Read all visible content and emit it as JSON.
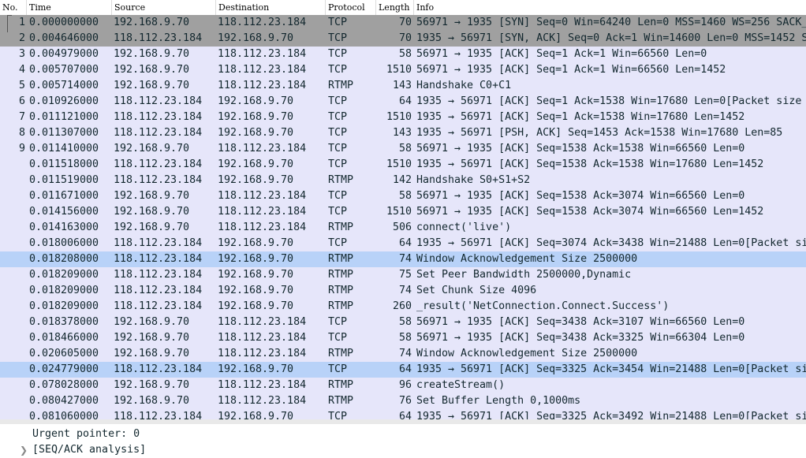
{
  "columns": {
    "no": "No.",
    "time": "Time",
    "source": "Source",
    "destination": "Destination",
    "protocol": "Protocol",
    "length": "Length",
    "info": "Info"
  },
  "packets": [
    {
      "no": "1",
      "time": "0.000000000",
      "src": "192.168.9.70",
      "dst": "118.112.23.184",
      "proto": "TCP",
      "len": "70",
      "info": "56971 → 1935 [SYN] Seq=0 Win=64240 Len=0 MSS=1460 WS=256 SACK_",
      "style": "sel-dark"
    },
    {
      "no": "2",
      "time": "0.004646000",
      "src": "118.112.23.184",
      "dst": "192.168.9.70",
      "proto": "TCP",
      "len": "70",
      "info": "1935 → 56971 [SYN, ACK] Seq=0 Ack=1 Win=14600 Len=0 MSS=1452 S",
      "style": "sel-dark"
    },
    {
      "no": "3",
      "time": "0.004979000",
      "src": "192.168.9.70",
      "dst": "118.112.23.184",
      "proto": "TCP",
      "len": "58",
      "info": "56971 → 1935 [ACK] Seq=1 Ack=1 Win=66560 Len=0",
      "style": ""
    },
    {
      "no": "4",
      "time": "0.005707000",
      "src": "192.168.9.70",
      "dst": "118.112.23.184",
      "proto": "TCP",
      "len": "1510",
      "info": "56971 → 1935 [ACK] Seq=1 Ack=1 Win=66560 Len=1452",
      "style": ""
    },
    {
      "no": "5",
      "time": "0.005714000",
      "src": "192.168.9.70",
      "dst": "118.112.23.184",
      "proto": "RTMP",
      "len": "143",
      "info": "Handshake C0+C1",
      "style": ""
    },
    {
      "no": "6",
      "time": "0.010926000",
      "src": "118.112.23.184",
      "dst": "192.168.9.70",
      "proto": "TCP",
      "len": "64",
      "info": "1935 → 56971 [ACK] Seq=1 Ack=1538 Win=17680 Len=0[Packet size",
      "style": ""
    },
    {
      "no": "7",
      "time": "0.011121000",
      "src": "118.112.23.184",
      "dst": "192.168.9.70",
      "proto": "TCP",
      "len": "1510",
      "info": "1935 → 56971 [ACK] Seq=1 Ack=1538 Win=17680 Len=1452",
      "style": ""
    },
    {
      "no": "8",
      "time": "0.011307000",
      "src": "118.112.23.184",
      "dst": "192.168.9.70",
      "proto": "TCP",
      "len": "143",
      "info": "1935 → 56971 [PSH, ACK] Seq=1453 Ack=1538 Win=17680 Len=85",
      "style": ""
    },
    {
      "no": "9",
      "time": "0.011410000",
      "src": "192.168.9.70",
      "dst": "118.112.23.184",
      "proto": "TCP",
      "len": "58",
      "info": "56971 → 1935 [ACK] Seq=1538 Ack=1538 Win=66560 Len=0",
      "style": ""
    },
    {
      "no": "",
      "time": "0.011518000",
      "src": "118.112.23.184",
      "dst": "192.168.9.70",
      "proto": "TCP",
      "len": "1510",
      "info": "1935 → 56971 [ACK] Seq=1538 Ack=1538 Win=17680 Len=1452",
      "style": ""
    },
    {
      "no": "",
      "time": "0.011519000",
      "src": "118.112.23.184",
      "dst": "192.168.9.70",
      "proto": "RTMP",
      "len": "142",
      "info": "Handshake S0+S1+S2",
      "style": ""
    },
    {
      "no": "",
      "time": "0.011671000",
      "src": "192.168.9.70",
      "dst": "118.112.23.184",
      "proto": "TCP",
      "len": "58",
      "info": "56971 → 1935 [ACK] Seq=1538 Ack=3074 Win=66560 Len=0",
      "style": ""
    },
    {
      "no": "",
      "time": "0.014156000",
      "src": "192.168.9.70",
      "dst": "118.112.23.184",
      "proto": "TCP",
      "len": "1510",
      "info": "56971 → 1935 [ACK] Seq=1538 Ack=3074 Win=66560 Len=1452",
      "style": ""
    },
    {
      "no": "",
      "time": "0.014163000",
      "src": "192.168.9.70",
      "dst": "118.112.23.184",
      "proto": "RTMP",
      "len": "506",
      "info": "connect('live')",
      "style": ""
    },
    {
      "no": "",
      "time": "0.018006000",
      "src": "118.112.23.184",
      "dst": "192.168.9.70",
      "proto": "TCP",
      "len": "64",
      "info": "1935 → 56971 [ACK] Seq=3074 Ack=3438 Win=21488 Len=0[Packet si",
      "style": ""
    },
    {
      "no": "",
      "time": "0.018208000",
      "src": "118.112.23.184",
      "dst": "192.168.9.70",
      "proto": "RTMP",
      "len": "74",
      "info": "Window Acknowledgement Size 2500000",
      "style": "sel-light"
    },
    {
      "no": "",
      "time": "0.018209000",
      "src": "118.112.23.184",
      "dst": "192.168.9.70",
      "proto": "RTMP",
      "len": "75",
      "info": "Set Peer Bandwidth 2500000,Dynamic",
      "style": ""
    },
    {
      "no": "",
      "time": "0.018209000",
      "src": "118.112.23.184",
      "dst": "192.168.9.70",
      "proto": "RTMP",
      "len": "74",
      "info": "Set Chunk Size 4096",
      "style": ""
    },
    {
      "no": "",
      "time": "0.018209000",
      "src": "118.112.23.184",
      "dst": "192.168.9.70",
      "proto": "RTMP",
      "len": "260",
      "info": "_result('NetConnection.Connect.Success')",
      "style": ""
    },
    {
      "no": "",
      "time": "0.018378000",
      "src": "192.168.9.70",
      "dst": "118.112.23.184",
      "proto": "TCP",
      "len": "58",
      "info": "56971 → 1935 [ACK] Seq=3438 Ack=3107 Win=66560 Len=0",
      "style": ""
    },
    {
      "no": "",
      "time": "0.018466000",
      "src": "192.168.9.70",
      "dst": "118.112.23.184",
      "proto": "TCP",
      "len": "58",
      "info": "56971 → 1935 [ACK] Seq=3438 Ack=3325 Win=66304 Len=0",
      "style": ""
    },
    {
      "no": "",
      "time": "0.020605000",
      "src": "192.168.9.70",
      "dst": "118.112.23.184",
      "proto": "RTMP",
      "len": "74",
      "info": "Window Acknowledgement Size 2500000",
      "style": ""
    },
    {
      "no": "",
      "time": "0.024779000",
      "src": "118.112.23.184",
      "dst": "192.168.9.70",
      "proto": "TCP",
      "len": "64",
      "info": "1935 → 56971 [ACK] Seq=3325 Ack=3454 Win=21488 Len=0[Packet si",
      "style": "sel-light"
    },
    {
      "no": "",
      "time": "0.078028000",
      "src": "192.168.9.70",
      "dst": "118.112.23.184",
      "proto": "RTMP",
      "len": "96",
      "info": "createStream()",
      "style": ""
    },
    {
      "no": "",
      "time": "0.080427000",
      "src": "192.168.9.70",
      "dst": "118.112.23.184",
      "proto": "RTMP",
      "len": "76",
      "info": "Set Buffer Length 0,1000ms",
      "style": ""
    },
    {
      "no": "",
      "time": "0.081060000",
      "src": "118.112.23.184",
      "dst": "192.168.9.70",
      "proto": "TCP",
      "len": "64",
      "info": "1935 → 56971 [ACK] Seq=3325 Ack=3492 Win=21488 Len=0[Packet si",
      "style": ""
    }
  ],
  "details": {
    "urgent_pointer": "Urgent pointer: 0",
    "seq_ack": "[SEQ/ACK analysis]",
    "expand_icon": "chevron-right-icon"
  },
  "colors": {
    "row_bg": "#e6e6fa",
    "selected_dark": "#a0a0a0",
    "selected_light": "#b8d2f8",
    "text": "#12272e"
  }
}
